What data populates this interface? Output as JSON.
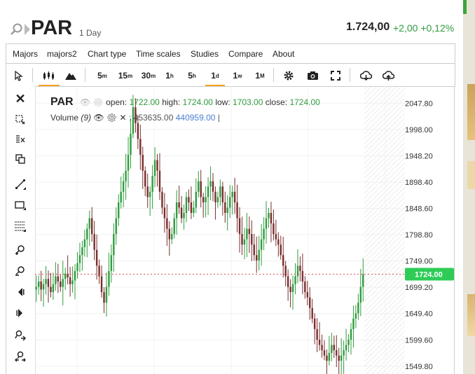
{
  "header": {
    "symbol": "PAR",
    "period": "1 Day",
    "last_price": "1.724,00",
    "change": "+2,00 +0,12%"
  },
  "menu": [
    "Majors",
    "majors2",
    "Chart type",
    "Time scales",
    "Studies",
    "Compare",
    "About"
  ],
  "toolbar": {
    "timeframes": [
      {
        "base": "5",
        "sup": "m"
      },
      {
        "base": "15",
        "sup": "m"
      },
      {
        "base": "30",
        "sup": "m"
      },
      {
        "base": "1",
        "sup": "h"
      },
      {
        "base": "5",
        "sup": "h"
      },
      {
        "base": "1",
        "sup": "d"
      },
      {
        "base": "1",
        "sup": "w"
      },
      {
        "base": "1",
        "sup": "M"
      }
    ],
    "selected_timeframe": "1d",
    "icons": [
      "cursor-icon",
      "candlestick-icon",
      "mountain-icon",
      "gear-icon",
      "camera-icon",
      "fullscreen-icon",
      "download-icon",
      "upload-icon"
    ]
  },
  "left_tools": [
    "close-icon",
    "zoom-select-icon",
    "delete-drawings-icon",
    "clone-icon",
    "trendline-icon",
    "rectangle-icon",
    "fibonacci-icon",
    "zoom-in-icon",
    "zoom-out-icon",
    "scroll-left-icon",
    "scroll-right-icon",
    "scroll-fit-icon",
    "zoom-reset-icon"
  ],
  "legend": {
    "symbol": "PAR",
    "open_label": "open:",
    "open": "1722.00",
    "high_label": "high:",
    "high": "1724.00",
    "low_label": "low:",
    "low": "1703.00",
    "close_label": "close:",
    "close": "1724.00",
    "volume_label": "Volume",
    "volume_period": "(9)",
    "volume_value": "453635.00",
    "volume_avg": "440959.00"
  },
  "colors": {
    "up": "#2f9d3e",
    "down": "#7a2e2e",
    "accent": "#f4a422",
    "price_tag": "#2ecc57",
    "volume_avg": "#4a7fd4"
  },
  "chart_data": {
    "type": "candlestick",
    "y_ticks": [
      "2047.80",
      "1998.00",
      "1948.20",
      "1898.40",
      "1848.60",
      "1798.80",
      "1749.00",
      "1699.20",
      "1649.40",
      "1599.60",
      "1549.80"
    ],
    "ylim": [
      1535,
      2080
    ],
    "current_price": 1724.0,
    "current_price_label": "1724.00",
    "grid": true,
    "closes": [
      1700,
      1710,
      1695,
      1705,
      1715,
      1700,
      1690,
      1705,
      1720,
      1710,
      1700,
      1715,
      1725,
      1718,
      1705,
      1712,
      1730,
      1745,
      1760,
      1775,
      1790,
      1810,
      1830,
      1800,
      1770,
      1740,
      1720,
      1690,
      1670,
      1700,
      1730,
      1760,
      1800,
      1830,
      1860,
      1880,
      1900,
      1920,
      1950,
      1990,
      2040,
      2010,
      1980,
      1950,
      1920,
      1890,
      1870,
      1880,
      1910,
      1940,
      1920,
      1880,
      1850,
      1830,
      1810,
      1790,
      1800,
      1830,
      1860,
      1850,
      1830,
      1840,
      1870,
      1860,
      1840,
      1850,
      1880,
      1900,
      1870,
      1860,
      1870,
      1890,
      1900,
      1880,
      1860,
      1870,
      1890,
      1860,
      1840,
      1850,
      1870,
      1880,
      1860,
      1830,
      1800,
      1780,
      1790,
      1810,
      1800,
      1780,
      1760,
      1750,
      1770,
      1790,
      1810,
      1830,
      1840,
      1820,
      1800,
      1790,
      1780,
      1760,
      1740,
      1720,
      1700,
      1690,
      1705,
      1720,
      1740,
      1730,
      1710,
      1690,
      1680,
      1660,
      1640,
      1620,
      1600,
      1590,
      1580,
      1570,
      1560,
      1575,
      1590,
      1580,
      1570,
      1560,
      1570,
      1580,
      1590,
      1600,
      1620,
      1640,
      1650,
      1670,
      1700,
      1724
    ]
  }
}
